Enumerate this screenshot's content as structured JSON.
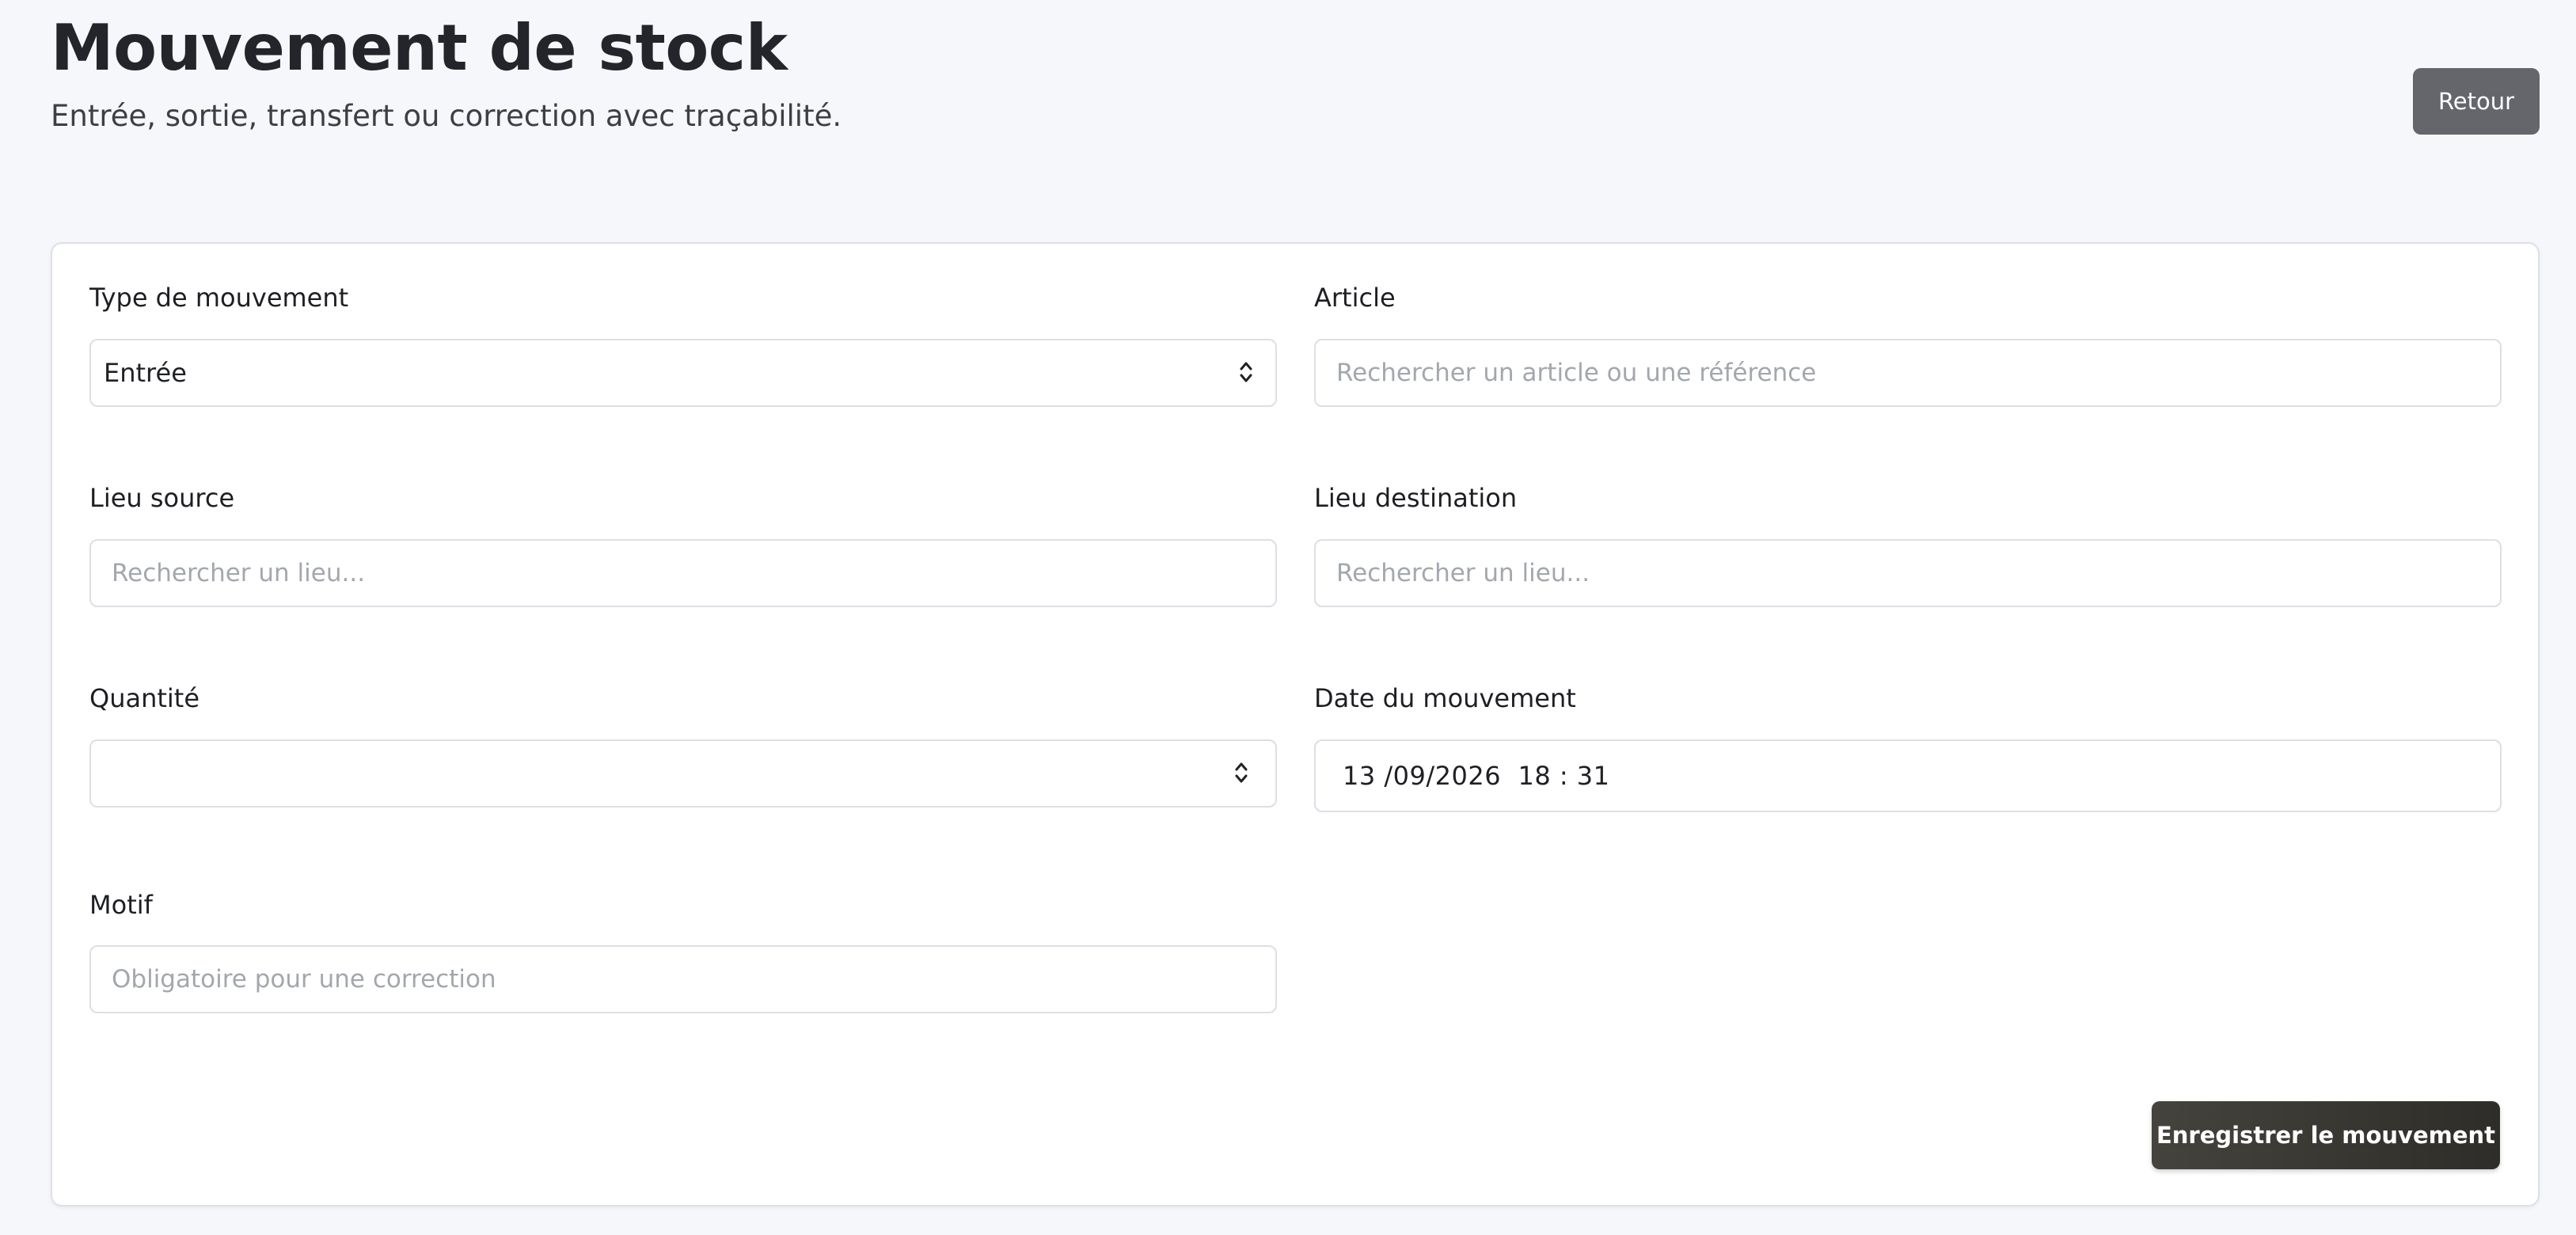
{
  "header": {
    "title": "Mouvement de stock",
    "subtitle": "Entrée, sortie, transfert ou correction avec traçabilité.",
    "back_label": "Retour"
  },
  "form": {
    "movement_type": {
      "label": "Type de mouvement",
      "value": "Entrée"
    },
    "article": {
      "label": "Article",
      "placeholder": "Rechercher un article ou une référence"
    },
    "source_location": {
      "label": "Lieu source",
      "placeholder": "Rechercher un lieu..."
    },
    "destination_location": {
      "label": "Lieu destination",
      "placeholder": "Rechercher un lieu..."
    },
    "quantity": {
      "label": "Quantité",
      "value": ""
    },
    "movement_date": {
      "label": "Date du mouvement",
      "value": "13 /09/2026  18 : 31"
    },
    "reason": {
      "label": "Motif",
      "placeholder": "Obligatoire pour une correction"
    },
    "submit_label": "Enregistrer le mouvement"
  },
  "icons": {
    "select_chevron": "chevron-up-down-icon",
    "number_spinner": "spinner-icon"
  },
  "colors": {
    "page_background": "#f6f7fa",
    "back_button": "#64666c",
    "submit_button": "#3a3934",
    "placeholder": "#a3a7ae"
  }
}
